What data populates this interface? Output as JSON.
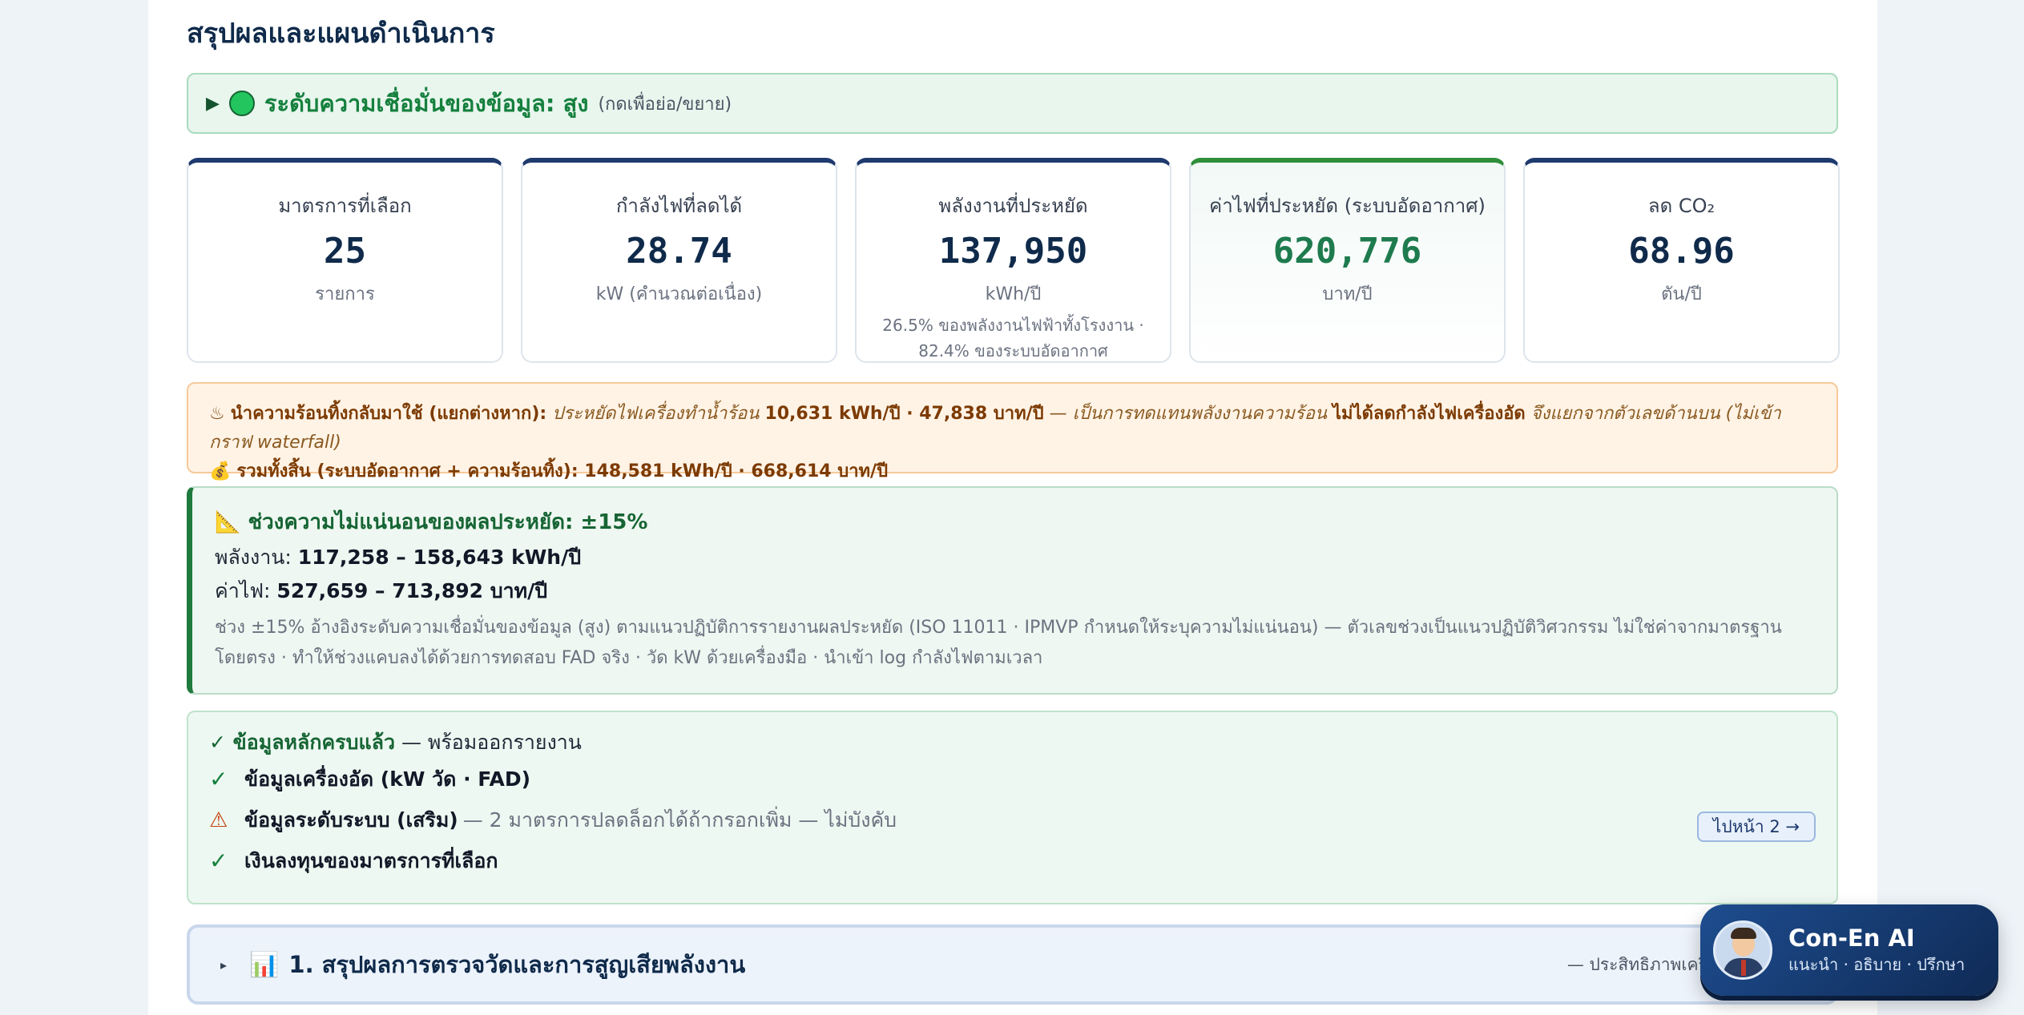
{
  "page": {
    "title": "สรุปผลและแผนดำเนินการ"
  },
  "confidence": {
    "toggle_icon": "▶",
    "status_color": "#22c55e",
    "text": "ระดับความเชื่อมั่นของข้อมูล: สูง",
    "hint": "(กดเพื่อย่อ/ขยาย)"
  },
  "metrics": [
    {
      "label": "มาตรการที่เลือก",
      "value": "25",
      "unit": "รายการ",
      "note": ""
    },
    {
      "label": "กำลังไฟที่ลดได้",
      "value": "28.74",
      "unit": "kW (คำนวณต่อเนื่อง)",
      "note": ""
    },
    {
      "label": "พลังงานที่ประหยัด",
      "value": "137,950",
      "unit": "kWh/ปี",
      "note": "26.5% ของพลังงานไฟฟ้าทั้งโรงงาน · 82.4% ของระบบอัดอากาศ"
    },
    {
      "label": "ค่าไฟที่ประหยัด (ระบบอัดอากาศ)",
      "value": "620,776",
      "unit": "บาท/ปี",
      "note": ""
    },
    {
      "label": "ลด CO₂",
      "value": "68.96",
      "unit": "ตัน/ปี",
      "note": ""
    }
  ],
  "heat": {
    "icon": "♨",
    "lead": "นำความร้อนทิ้งกลับมาใช้ (แยกต่างหาก):",
    "desc1": "ประหยัดไฟเครื่องทำน้ำร้อน",
    "kwh": "10,631 kWh/ปี · 47,838 บาท/ปี",
    "desc2": "— เป็นการทดแทนพลังงานความร้อน",
    "emph": "ไม่ได้ลดกำลังไฟเครื่องอัด",
    "desc3": "จึงแยกจากตัวเลขด้านบน (ไม่เข้ากราฟ waterfall)",
    "total_icon": "💰",
    "total": "รวมทั้งสิ้น (ระบบอัดอากาศ + ความร้อนทิ้ง): 148,581 kWh/ปี · 668,614 บาท/ปี"
  },
  "uncertainty": {
    "icon": "📐",
    "title": "ช่วงความไม่แน่นอนของผลประหยัด: ±15%",
    "energy_label": "พลังงาน:",
    "energy_value": "117,258 – 158,643 kWh/ปี",
    "cost_label": "ค่าไฟ:",
    "cost_value": "527,659 – 713,892 บาท/ปี",
    "note": "ช่วง ±15% อ้างอิงระดับความเชื่อมั่นของข้อมูล (สูง) ตามแนวปฏิบัติการรายงานผลประหยัด (ISO 11011 · IPMVP กำหนดให้ระบุความไม่แน่นอน) — ตัวเลขช่วงเป็นแนวปฏิบัติวิศวกรรม ไม่ใช่ค่าจากมาตรฐานโดยตรง · ทำให้ช่วงแคบลงได้ด้วยการทดสอบ FAD จริง · วัด kW ด้วยเครื่องมือ · นำเข้า log กำลังไฟตามเวลา"
  },
  "data_status": {
    "head_ok": "✓ ข้อมูลหลักครบแล้ว",
    "head_rest": "— พร้อมออกรายงาน",
    "items": [
      {
        "mark": "✓",
        "label": "ข้อมูลเครื่องอัด (kW วัด · FAD)",
        "sub": ""
      },
      {
        "mark": "⚠",
        "label": "ข้อมูลระดับระบบ (เสริม)",
        "sub": "— 2 มาตรการปลดล็อกได้ถ้ากรอกเพิ่ม — ไม่บังคับ"
      },
      {
        "mark": "✓",
        "label": "เงินลงทุนของมาตรการที่เลือก",
        "sub": ""
      }
    ],
    "goto_label": "ไปหน้า 2 →"
  },
  "section1": {
    "toggle_icon": "▸",
    "icon": "📊",
    "title": "1. สรุปผลการตรวจวัดและการสูญเสียพลังงาน",
    "subtitle": "— ประสิทธิภาพเครื่องอัด"
  },
  "chat": {
    "name": "Con-En AI",
    "tagline": "แนะนำ · อธิบาย · ปรึกษา"
  }
}
